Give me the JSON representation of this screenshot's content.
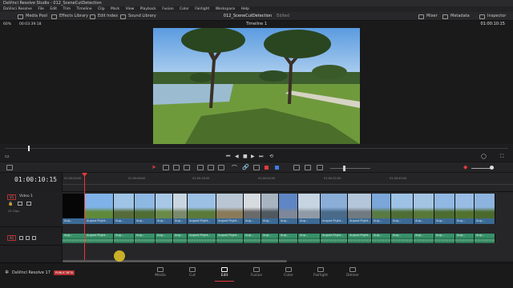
{
  "window_title": "DaVinci Resolve Studio - 012_SceneCutDetection",
  "menu": [
    "DaVinci Resolve",
    "File",
    "Edit",
    "Trim",
    "Timeline",
    "Clip",
    "Mark",
    "View",
    "Playback",
    "Fusion",
    "Color",
    "Fairlight",
    "Workspace",
    "Help"
  ],
  "toolbar": {
    "media_pool": "Media Pool",
    "effects_library": "Effects Library",
    "edit_index": "Edit Index",
    "sound_library": "Sound Library",
    "project_name": "012_SceneCutDetection",
    "edited": "Edited",
    "mixer": "Mixer",
    "metadata": "Metadata",
    "inspector": "Inspector"
  },
  "viewer": {
    "zoom": "60%",
    "source_timecode": "00:03:39:18",
    "timeline_name": "Timeline 1",
    "timecode": "01:00:10:15"
  },
  "timeline": {
    "timecode": "01:00:10:15",
    "ruler_ticks": [
      "01:00:00:00",
      "01:00:08:00",
      "01:00:16:00",
      "01:00:24:00",
      "01:00:32:00",
      "01:00:40:00"
    ],
    "video_track": {
      "id": "V1",
      "name": "Video 1",
      "clip_count": "25 Clips"
    },
    "audio_track": {
      "id": "A1"
    },
    "clip_label": "August Flight...",
    "clip_label_short": "Aug...",
    "audio_label": "August Flight..."
  },
  "pages": [
    "Media",
    "Cut",
    "Edit",
    "Fusion",
    "Color",
    "Fairlight",
    "Deliver"
  ],
  "active_page": "Edit",
  "brand": {
    "name": "DaVinci Resolve 17",
    "badge": "PUBLIC BETA"
  },
  "colors": {
    "playhead": "#e23b3b",
    "video_clip": "#3c6a95",
    "audio_clip": "#2f7a57"
  }
}
